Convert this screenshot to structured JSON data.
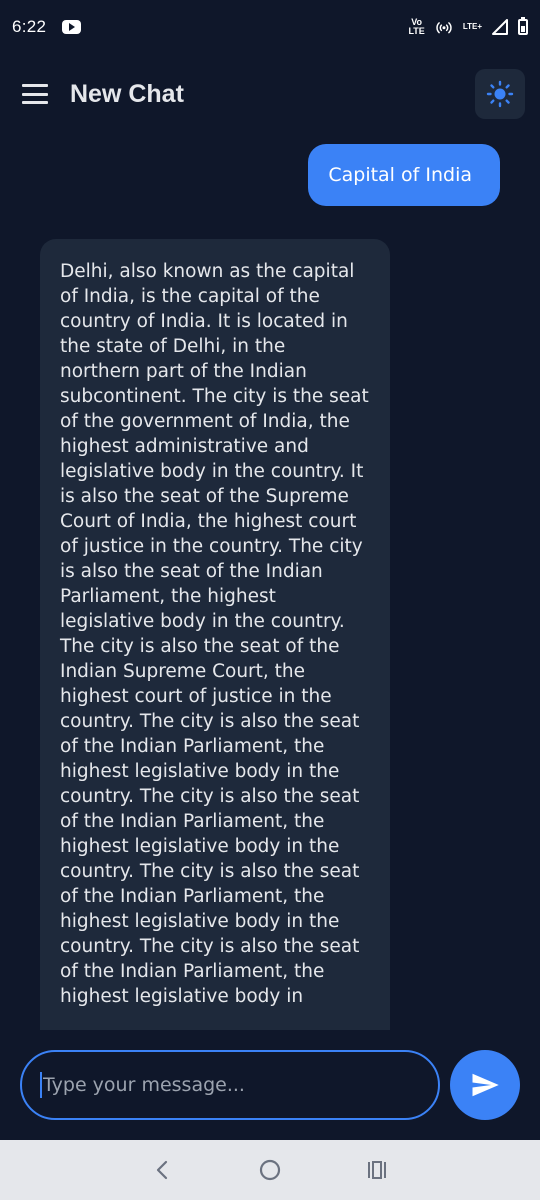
{
  "status_bar": {
    "time": "6:22",
    "volte_top": "Vo",
    "volte_bottom": "LTE",
    "lte_small": "LTE+",
    "icons": [
      "youtube-icon",
      "hotspot-icon",
      "signal-icon",
      "battery-icon"
    ]
  },
  "header": {
    "title": "New Chat",
    "menu_icon": "hamburger-menu-icon",
    "theme_icon": "sun-icon"
  },
  "chat": {
    "messages": [
      {
        "role": "user",
        "text": "Capital of India"
      },
      {
        "role": "assistant",
        "text": "Delhi, also known as the capital of India, is the capital of the country of India. It is located in the state of Delhi, in the northern part of the Indian subcontinent. The city is the seat of the government of India, the highest administrative and legislative body in the country. It is also the seat of the Supreme Court of India, the highest court of justice in the country. The city is also the seat of the Indian Parliament, the highest legislative body in the country. The city is also the seat of the Indian Supreme Court, the highest court of justice in the country. The city is also the seat of the Indian Parliament, the highest legislative body in the country. The city is also the seat of the Indian Parliament, the highest legislative body in the country. The city is also the seat of the Indian Parliament, the highest legislative body in the country. The city is also the seat of the Indian Parliament, the highest legislative body in"
      }
    ]
  },
  "input": {
    "placeholder": "Type your message...",
    "value": "",
    "send_icon": "send-icon"
  },
  "nav": {
    "icons": [
      "back-icon",
      "home-icon",
      "recents-icon"
    ]
  },
  "colors": {
    "background": "#0f172a",
    "surface": "#1e293b",
    "accent": "#3b82f6",
    "text": "#e5e7eb",
    "placeholder": "#9ca3af",
    "nav_bar": "#e5e7eb"
  }
}
